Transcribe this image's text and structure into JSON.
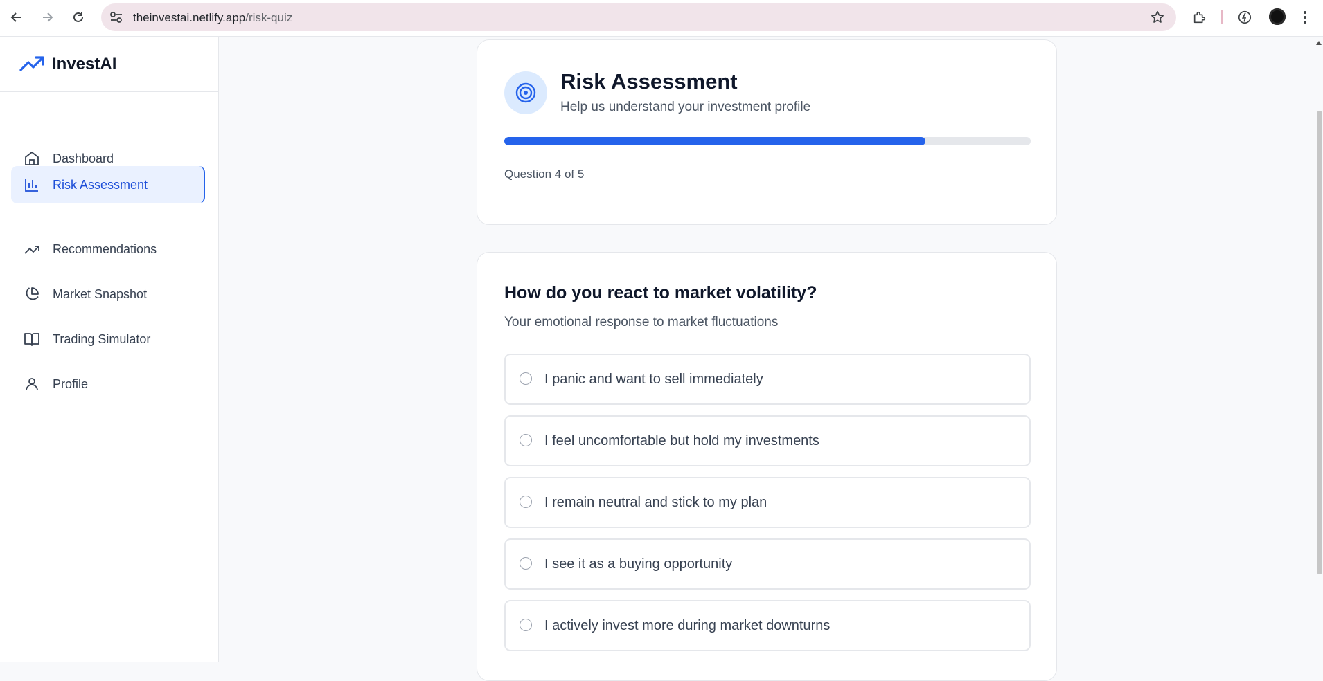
{
  "browser": {
    "url_host": "theinvestai.netlify.app",
    "url_path": "/risk-quiz"
  },
  "sidebar": {
    "brand": "InvestAI",
    "items": [
      {
        "label": "Dashboard",
        "icon": "home-icon",
        "active": false
      },
      {
        "label": "Risk Assessment",
        "icon": "bar-chart-icon",
        "active": true
      },
      {
        "label": "Recommendations",
        "icon": "trending-up-icon",
        "active": false
      },
      {
        "label": "Market Snapshot",
        "icon": "pie-chart-icon",
        "active": false
      },
      {
        "label": "Trading Simulator",
        "icon": "book-open-icon",
        "active": false
      },
      {
        "label": "Profile",
        "icon": "user-icon",
        "active": false
      }
    ]
  },
  "header_card": {
    "title": "Risk Assessment",
    "subtitle": "Help us understand your investment profile",
    "progress_fraction": 0.8,
    "question_counter": "Question 4 of 5"
  },
  "quiz": {
    "question": "How do you react to market volatility?",
    "description": "Your emotional response to market fluctuations",
    "options": [
      "I panic and want to sell immediately",
      "I feel uncomfortable but hold my investments",
      "I remain neutral and stick to my plan",
      "I see it as a buying opportunity",
      "I actively invest more during market downturns"
    ]
  },
  "colors": {
    "accent": "#2563eb",
    "active_bg": "#eaf1ff",
    "progress_track": "#e5e7eb"
  }
}
